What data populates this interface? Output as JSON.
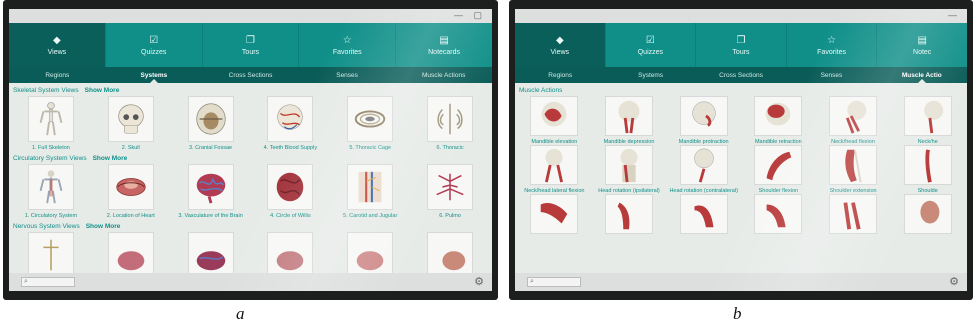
{
  "colors": {
    "teal": "#0f8f88",
    "dark_teal": "#0a5c58",
    "muscle": "#b83a3a",
    "bone": "#e6e2d6"
  },
  "photo_a": {
    "tabs": [
      {
        "label": "Views",
        "icon": "cube-icon"
      },
      {
        "label": "Quizzes",
        "icon": "checkbox-icon"
      },
      {
        "label": "Tours",
        "icon": "tours-icon"
      },
      {
        "label": "Favorites",
        "icon": "star-icon"
      },
      {
        "label": "Notecards",
        "icon": "notecard-icon"
      }
    ],
    "subnav": [
      "Regions",
      "Systems",
      "Cross Sections",
      "Senses",
      "Muscle Actions"
    ],
    "sections": [
      {
        "title": "Skeletal System Views",
        "more": "Show More",
        "items": [
          "1. Full Skeleton",
          "2. Skull",
          "3. Cranial Fossae",
          "4. Teeth Blood Supply",
          "5. Thoracic Cage",
          "6. Thoracic"
        ]
      },
      {
        "title": "Circulatory System Views",
        "more": "Show More",
        "items": [
          "1. Circulatory System",
          "2. Location of Heart",
          "3. Vasculature of the Brain",
          "4. Circle of Willis",
          "5. Carotid and Jugular",
          "6. Pulmo"
        ]
      },
      {
        "title": "Nervous System Views",
        "more": "Show More",
        "items": [
          "",
          "",
          "",
          "",
          "",
          ""
        ]
      }
    ]
  },
  "photo_b": {
    "tabs": [
      {
        "label": "Views",
        "icon": "cube-icon"
      },
      {
        "label": "Quizzes",
        "icon": "checkbox-icon"
      },
      {
        "label": "Tours",
        "icon": "tours-icon"
      },
      {
        "label": "Favorites",
        "icon": "star-icon"
      },
      {
        "label": "Notec",
        "icon": "notecard-icon"
      }
    ],
    "subnav": [
      "Regions",
      "Systems",
      "Cross Sections",
      "Senses",
      "Muscle Actio"
    ],
    "section_title": "Muscle Actions",
    "rows": [
      [
        "Mandible elevation",
        "Mandible depression",
        "Mandible protraction",
        "Mandible retraction",
        "Neck/head flexion",
        "Neck/he"
      ],
      [
        "Neck/head lateral flexion",
        "Head rotation (ipsilateral)",
        "Head rotation (contralateral)",
        "Shoulder flexion",
        "Shoulder extension",
        "Shoulde"
      ],
      [
        "",
        "",
        "",
        "",
        "",
        ""
      ]
    ]
  },
  "captions": {
    "a": "a",
    "b": "b"
  }
}
